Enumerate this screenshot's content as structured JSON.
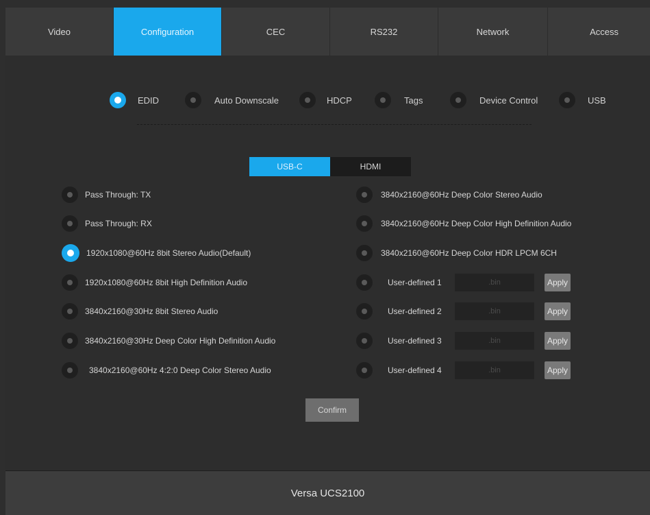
{
  "nav": {
    "tabs": [
      "Video",
      "Configuration",
      "CEC",
      "RS232",
      "Network",
      "Access"
    ],
    "active": "Configuration"
  },
  "subnav": {
    "items": [
      "EDID",
      "Auto Downscale",
      "HDCP",
      "Tags",
      "Device Control",
      "USB"
    ],
    "selected": "EDID"
  },
  "source_toggle": {
    "options": [
      "USB-C",
      "HDMI"
    ],
    "selected": "USB-C"
  },
  "edid": {
    "left_options": [
      "Pass Through: TX",
      "Pass Through: RX",
      "1920x1080@60Hz 8bit Stereo Audio(Default)",
      "1920x1080@60Hz 8bit High Definition Audio",
      "3840x2160@30Hz 8bit Stereo Audio",
      "3840x2160@30Hz Deep Color High Definition Audio",
      "3840x2160@60Hz 4:2:0 Deep Color Stereo Audio"
    ],
    "right_options": [
      "3840x2160@60Hz Deep Color Stereo Audio",
      "3840x2160@60Hz Deep Color High Definition Audio",
      "3840x2160@60Hz Deep Color HDR LPCM 6CH"
    ],
    "user_defined": [
      {
        "label": "User-defined 1",
        "placeholder": ".bin",
        "apply": "Apply"
      },
      {
        "label": "User-defined 2",
        "placeholder": ".bin",
        "apply": "Apply"
      },
      {
        "label": "User-defined 3",
        "placeholder": ".bin",
        "apply": "Apply"
      },
      {
        "label": "User-defined 4",
        "placeholder": ".bin",
        "apply": "Apply"
      }
    ],
    "selected": "1920x1080@60Hz 8bit Stereo Audio(Default)"
  },
  "confirm_label": "Confirm",
  "footer": {
    "device_name": "Versa UCS2100"
  },
  "colors": {
    "accent": "#1aa8ec",
    "background": "#2e2e2e",
    "nav_bg": "#3a3a3a"
  }
}
